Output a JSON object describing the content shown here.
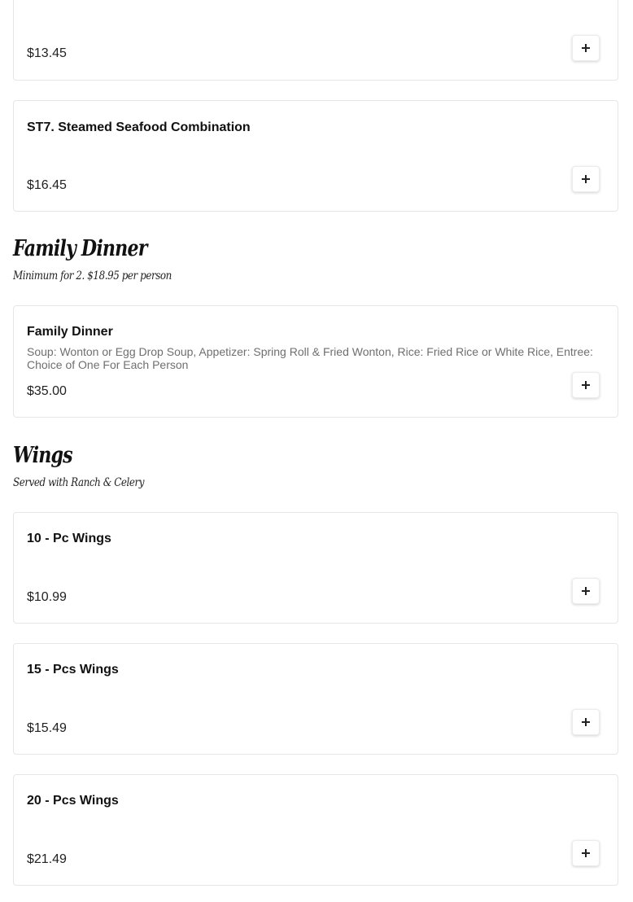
{
  "items_top": [
    {
      "name": "",
      "price": "$13.45"
    },
    {
      "name": "ST7. Steamed Seafood Combination",
      "price": "$16.45"
    }
  ],
  "family_dinner": {
    "title": "Family Dinner",
    "subtitle": "Minimum for 2. $18.95 per person",
    "items": [
      {
        "name": "Family Dinner",
        "description": "Soup: Wonton or Egg Drop Soup, Appetizer: Spring Roll & Fried Wonton, Rice: Fried Rice or White Rice, Entree: Choice of One For Each Person",
        "price": "$35.00"
      }
    ]
  },
  "wings": {
    "title": "Wings",
    "subtitle": "Served with Ranch & Celery",
    "items": [
      {
        "name": "10 - Pc Wings",
        "price": "$10.99"
      },
      {
        "name": "15 - Pcs Wings",
        "price": "$15.49"
      },
      {
        "name": "20 - Pcs Wings",
        "price": "$21.49"
      }
    ]
  },
  "icons": {
    "add": "plus-icon"
  }
}
